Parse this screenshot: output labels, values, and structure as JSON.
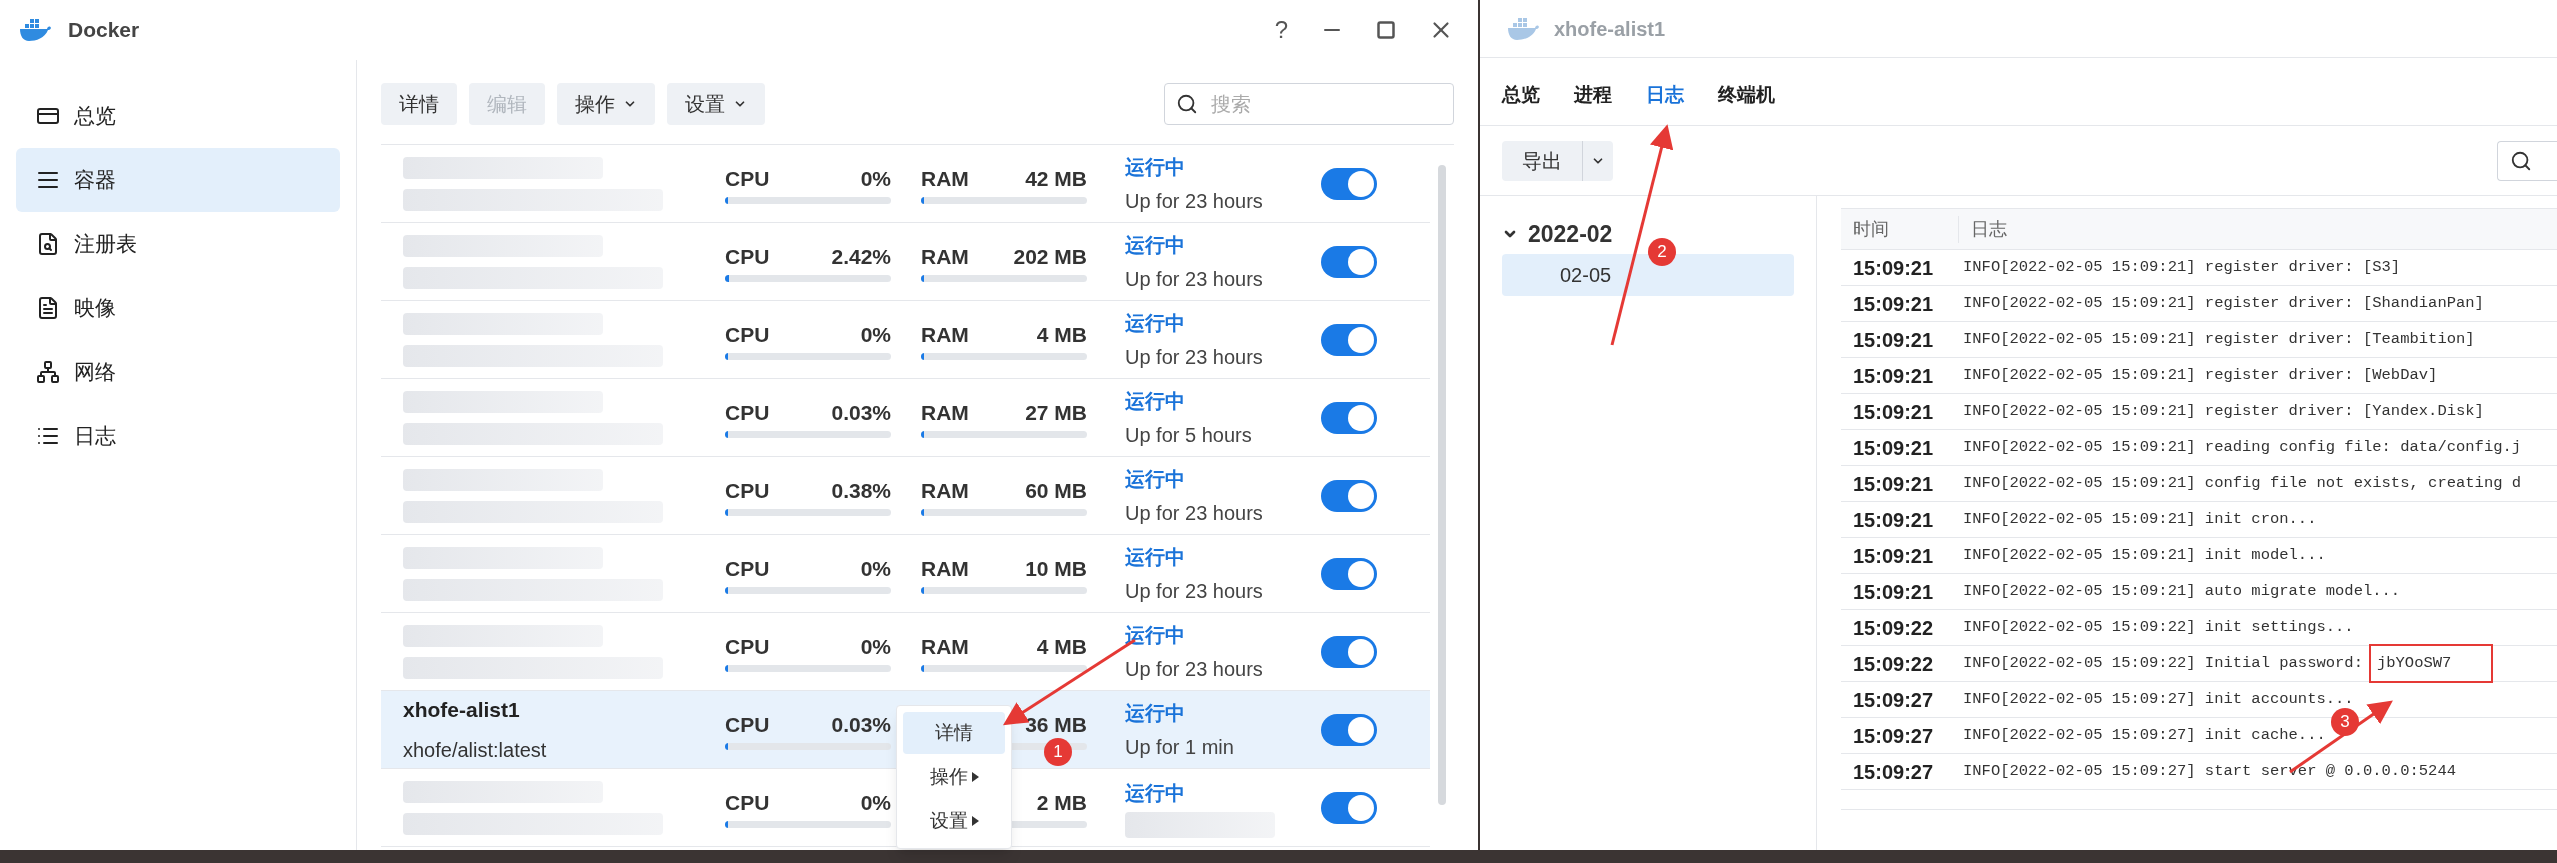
{
  "window": {
    "title": "Docker",
    "help": "?"
  },
  "sidebar": {
    "items": [
      {
        "label": "总览",
        "selected": false
      },
      {
        "label": "容器",
        "selected": true
      },
      {
        "label": "注册表",
        "selected": false
      },
      {
        "label": "映像",
        "selected": false
      },
      {
        "label": "网络",
        "selected": false
      },
      {
        "label": "日志",
        "selected": false
      }
    ]
  },
  "toolbar": {
    "buttons": [
      {
        "label": "详情",
        "disabled": false,
        "dropdown": false
      },
      {
        "label": "编辑",
        "disabled": true,
        "dropdown": false
      },
      {
        "label": "操作",
        "disabled": false,
        "dropdown": true
      },
      {
        "label": "设置",
        "disabled": false,
        "dropdown": true
      }
    ],
    "search": {
      "placeholder": "搜索"
    }
  },
  "containers": [
    {
      "kind": "blurred",
      "cpu": {
        "label": "CPU",
        "value": "0%",
        "level": 0
      },
      "ram": {
        "label": "RAM",
        "value": "42 MB",
        "level": 0.01
      },
      "status": "运行中",
      "uptime": "Up for 23 hours",
      "on": true,
      "selected": false
    },
    {
      "kind": "blurred",
      "cpu": {
        "label": "CPU",
        "value": "2.42%",
        "level": 0.0242
      },
      "ram": {
        "label": "RAM",
        "value": "202 MB",
        "level": 0.01
      },
      "status": "运行中",
      "uptime": "Up for 23 hours",
      "on": true,
      "selected": false
    },
    {
      "kind": "blurred",
      "cpu": {
        "label": "CPU",
        "value": "0%",
        "level": 0
      },
      "ram": {
        "label": "RAM",
        "value": "4 MB",
        "level": 0.01
      },
      "status": "运行中",
      "uptime": "Up for 23 hours",
      "on": true,
      "selected": false
    },
    {
      "kind": "blurred",
      "cpu": {
        "label": "CPU",
        "value": "0.03%",
        "level": 0.003
      },
      "ram": {
        "label": "RAM",
        "value": "27 MB",
        "level": 0.01
      },
      "status": "运行中",
      "uptime": "Up for 5 hours",
      "on": true,
      "selected": false
    },
    {
      "kind": "blurred",
      "cpu": {
        "label": "CPU",
        "value": "0.38%",
        "level": 0.0038
      },
      "ram": {
        "label": "RAM",
        "value": "60 MB",
        "level": 0.01
      },
      "status": "运行中",
      "uptime": "Up for 23 hours",
      "on": true,
      "selected": false
    },
    {
      "kind": "blurred",
      "cpu": {
        "label": "CPU",
        "value": "0%",
        "level": 0
      },
      "ram": {
        "label": "RAM",
        "value": "10 MB",
        "level": 0.01
      },
      "status": "运行中",
      "uptime": "Up for 23 hours",
      "on": true,
      "selected": false
    },
    {
      "kind": "blurred",
      "cpu": {
        "label": "CPU",
        "value": "0%",
        "level": 0
      },
      "ram": {
        "label": "RAM",
        "value": "4 MB",
        "level": 0.01
      },
      "status": "运行中",
      "uptime": "Up for 23 hours",
      "on": true,
      "selected": false
    },
    {
      "kind": "named",
      "name": "xhofe-alist1",
      "image": "xhofe/alist:latest",
      "cpu": {
        "label": "CPU",
        "value": "0.03%",
        "level": 0.003
      },
      "ram": {
        "value": "36 MB",
        "level": 0.01
      },
      "status": "运行中",
      "uptime": "Up for 1 min",
      "on": true,
      "selected": true
    },
    {
      "kind": "blurred",
      "cpu": {
        "label": "CPU",
        "value": "0%",
        "level": 0
      },
      "ram": {
        "value": "2 MB",
        "level": 0.01
      },
      "status": "运行中",
      "on": true,
      "selected": false
    }
  ],
  "context_menu": {
    "items": [
      {
        "label": "详情",
        "submenu": false,
        "selected": true
      },
      {
        "label": "操作",
        "submenu": true,
        "selected": false
      },
      {
        "label": "设置",
        "submenu": true,
        "selected": false
      }
    ]
  },
  "detail_window": {
    "title": "xhofe-alist1",
    "tabs": [
      {
        "label": "总览",
        "selected": false
      },
      {
        "label": "进程",
        "selected": false
      },
      {
        "label": "日志",
        "selected": true
      },
      {
        "label": "终端机",
        "selected": false
      }
    ],
    "export_button": "导出",
    "tree": [
      {
        "label": "2022-02",
        "expanded": true,
        "children": [
          {
            "label": "02-05",
            "selected": true
          }
        ]
      }
    ],
    "log_columns": [
      "时间",
      "日志"
    ],
    "log_rows": [
      {
        "time": "15:09:21",
        "message": "INFO[2022-02-05 15:09:21] register driver: [S3]"
      },
      {
        "time": "15:09:21",
        "message": "INFO[2022-02-05 15:09:21] register driver: [ShandianPan]"
      },
      {
        "time": "15:09:21",
        "message": "INFO[2022-02-05 15:09:21] register driver: [Teambition]"
      },
      {
        "time": "15:09:21",
        "message": "INFO[2022-02-05 15:09:21] register driver: [WebDav]"
      },
      {
        "time": "15:09:21",
        "message": "INFO[2022-02-05 15:09:21] register driver: [Yandex.Disk]"
      },
      {
        "time": "15:09:21",
        "message": "INFO[2022-02-05 15:09:21] reading config file: data/config.j"
      },
      {
        "time": "15:09:21",
        "message": "INFO[2022-02-05 15:09:21] config file not exists, creating d"
      },
      {
        "time": "15:09:21",
        "message": "INFO[2022-02-05 15:09:21] init cron..."
      },
      {
        "time": "15:09:21",
        "message": "INFO[2022-02-05 15:09:21] init model..."
      },
      {
        "time": "15:09:21",
        "message": "INFO[2022-02-05 15:09:21] auto migrate model..."
      },
      {
        "time": "15:09:22",
        "message": "INFO[2022-02-05 15:09:22] init settings..."
      },
      {
        "time": "15:09:22",
        "message": "INFO[2022-02-05 15:09:22] Initial password:",
        "boxed": "jbYOoSW7"
      },
      {
        "time": "15:09:27",
        "message": "INFO[2022-02-05 15:09:27] init accounts..."
      },
      {
        "time": "15:09:27",
        "message": "INFO[2022-02-05 15:09:27] init cache..."
      },
      {
        "time": "15:09:27",
        "message": "INFO[2022-02-05 15:09:27] start server @ 0.0.0.0:5244"
      }
    ]
  },
  "annotations": [
    {
      "label": "1"
    },
    {
      "label": "2"
    },
    {
      "label": "3"
    }
  ]
}
